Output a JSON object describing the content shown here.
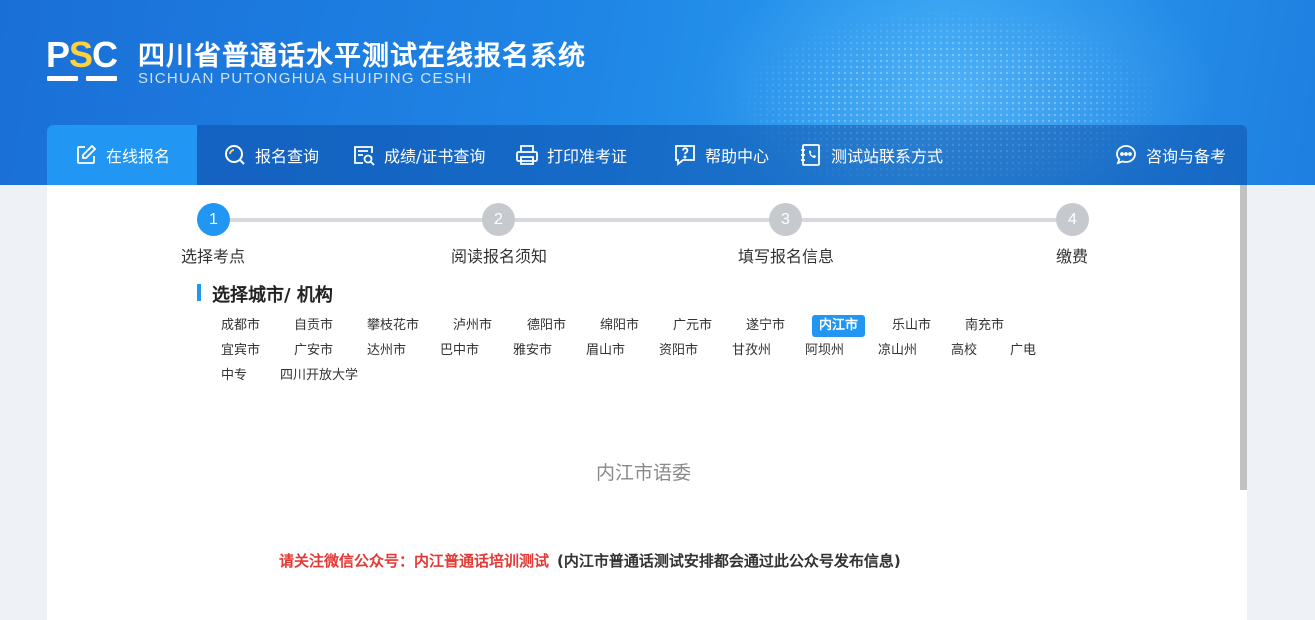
{
  "header": {
    "logo_text": "PSC",
    "title": "四川省普通话水平测试在线报名系统",
    "subtitle": "SICHUAN PUTONGHUA SHUIPING CESHI",
    "colors": {
      "primary": "#2196f3",
      "banner": "#1f86e6",
      "logo_accent": "#ffd23c"
    }
  },
  "nav": {
    "items": [
      {
        "label": "在线报名",
        "icon": "edit-icon",
        "active": true
      },
      {
        "label": "报名查询",
        "icon": "search-circle-icon",
        "active": false
      },
      {
        "label": "成绩/证书查询",
        "icon": "certificate-search-icon",
        "active": false
      },
      {
        "label": "打印准考证",
        "icon": "printer-icon",
        "active": false
      },
      {
        "label": "帮助中心",
        "icon": "help-icon",
        "active": false
      },
      {
        "label": "测试站联系方式",
        "icon": "contact-book-icon",
        "active": false
      },
      {
        "label": "咨询与备考",
        "icon": "chat-icon",
        "active": false
      }
    ]
  },
  "steps": [
    {
      "number": "1",
      "label": "选择考点",
      "active": true
    },
    {
      "number": "2",
      "label": "阅读报名须知",
      "active": false
    },
    {
      "number": "3",
      "label": "填写报名信息",
      "active": false
    },
    {
      "number": "4",
      "label": "缴费",
      "active": false
    }
  ],
  "section": {
    "title": "选择城市/ 机构"
  },
  "cities": [
    "成都市",
    "自贡市",
    "攀枝花市",
    "泸州市",
    "德阳市",
    "绵阳市",
    "广元市",
    "遂宁市",
    "内江市",
    "乐山市",
    "南充市",
    "宜宾市",
    "广安市",
    "达州市",
    "巴中市",
    "雅安市",
    "眉山市",
    "资阳市",
    "甘孜州",
    "阿坝州",
    "凉山州",
    "高校",
    "广电",
    "中专",
    "四川开放大学"
  ],
  "selected_city": "内江市",
  "org": {
    "name": "内江市语委"
  },
  "notice": {
    "highlight": "请关注微信公众号：内江普通话培训测试",
    "detail": "(内江市普通话测试安排都会通过此公众号发布信息)"
  }
}
